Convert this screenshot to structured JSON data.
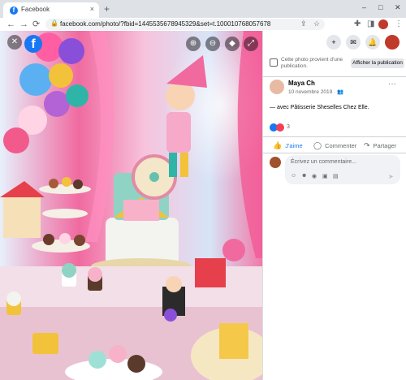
{
  "browser": {
    "tab_title": "Facebook",
    "tab_favicon": "f",
    "new_tab": "+",
    "tab_close": "×",
    "url": "facebook.com/photo/?fbid=1445535678945329&set=t.100010768057678",
    "back": "←",
    "forward": "→",
    "reload": "⟳",
    "lock": "🔒",
    "share": "⇪",
    "bookmark": "☆",
    "extensions": "✚",
    "sidepanel": "◨",
    "menu": "⋮",
    "win_min": "–",
    "win_max": "□",
    "win_close": "✕"
  },
  "viewer": {
    "close": "✕",
    "logo": "f",
    "zoom_in": "⊕",
    "zoom_out": "⊖",
    "tag": "◆",
    "fullscreen": "⤢"
  },
  "panel": {
    "add": "+",
    "messenger": "✉",
    "notifications": "🔔",
    "notice_text": "Cette photo provient d'une publication.",
    "show_publication": "Afficher la publication",
    "author": "Maya Ch",
    "date": "10 novembre 2019 · 👥",
    "more": "···",
    "caption": "— avec Pâtisserie Sheselles Chez Elle.",
    "reaction_count": "3",
    "like_label": "J'aime",
    "comment_label": "Commenter",
    "share_label": "Partager",
    "like_icon": "👍",
    "comment_icon": "◯",
    "share_icon": "↷",
    "comment_placeholder": "Écrivez un commentaire...",
    "tool_icons": [
      "☺",
      "☻",
      "◉",
      "▣",
      "▤"
    ],
    "send": "➤"
  },
  "colors": {
    "facebook_blue": "#1877f2",
    "love_red": "#f33e58"
  }
}
